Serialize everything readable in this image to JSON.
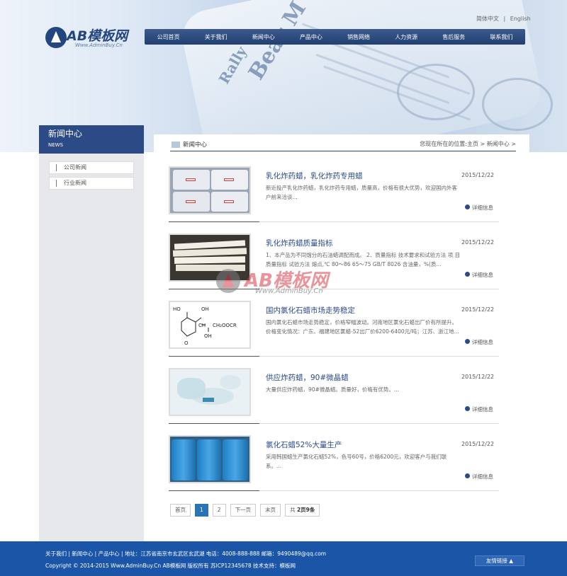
{
  "header": {
    "logo_text": "AB模板网",
    "logo_url": "Www.AdminBuy.Cn",
    "lang_cn": "简体中文",
    "lang_sep": "|",
    "lang_en": "English"
  },
  "hero_text": {
    "line1": "Bear M",
    "line2": "Rally"
  },
  "nav": [
    "公司首页",
    "关于我们",
    "新闻中心",
    "产品中心",
    "销售网络",
    "人力资源",
    "售后服务",
    "联系我们"
  ],
  "sidebar": {
    "title": "新闻中心",
    "subtitle": "NEWS",
    "items": [
      "公司新闻",
      "行业新闻"
    ]
  },
  "content": {
    "section_title": "新闻中心",
    "breadcrumb": "您现在所在的位置:主页 > 新闻中心 >",
    "more_label": "详细信息",
    "news": [
      {
        "title": "乳化炸药蜡，乳化炸药专用蜡",
        "date": "2015/12/22",
        "desc": "新近投产乳化炸药蜡，乳化炸药专用蜡，质量高，价格有很大优势，欢迎国内外客户前来洽谈..."
      },
      {
        "title": "乳化炸药蜡质量指标",
        "date": "2015/12/22",
        "desc": "1、本产品为不同馏分的石油蜡调配而成。 2、质量指标 技术要求和试验方法 项 目 质量指标 试验方法 熔点,℃ 80～86 65～75 GB/T 8026 含油量，%(质..."
      },
      {
        "title": "国内氯化石蜡市场走势稳定",
        "date": "2015/12/22",
        "desc": "国内氯化石蜡市场走势稳定，价格窄幅波动。河南地区氯化石蜡出厂价有所提升。价格变化情况：广东、福建地区氯蜡-52出厂价6200-6400元/吨；江苏、浙江地..."
      },
      {
        "title": "供应炸药蜡，90#微晶蜡",
        "date": "2015/12/22",
        "desc": "大量供应炸药蜡，90#微晶蜡。质量好，价格有优势。..."
      },
      {
        "title": "氯化石蜡52%大量生产",
        "date": "2015/12/22",
        "desc": "采用韩国蜡生产氯化石蜡52%，色号60号，价格6200元，欢迎客户与我们联系。..."
      }
    ],
    "chem_labels": {
      "ho": "HO",
      "oh1": "OH",
      "ch": "CH",
      "ch2": "CH₂OOCR",
      "oh2": "OH",
      "o": "O"
    }
  },
  "pager": {
    "first": "首页",
    "pages": [
      "1",
      "2"
    ],
    "current": "1",
    "next": "下一页",
    "last": "末页",
    "total_prefix": "共",
    "total_value": "2页9条"
  },
  "footer": {
    "line1": "关于我们 | 新闻中心 | 产品中心 | 地址：江苏省南京市玄武区玄武湖    电话：4008-888-888    邮箱：9490489@qq.com",
    "line2": "Copyright © 2014-2015 Www.AdminBuy.Cn AB模板网 版权所有   苏ICP12345678 技术支持：模板网",
    "links_label": "友情链接 ▲"
  },
  "watermark": {
    "name": "AB模板网",
    "url": "Www.AdminBuy.Cn"
  }
}
